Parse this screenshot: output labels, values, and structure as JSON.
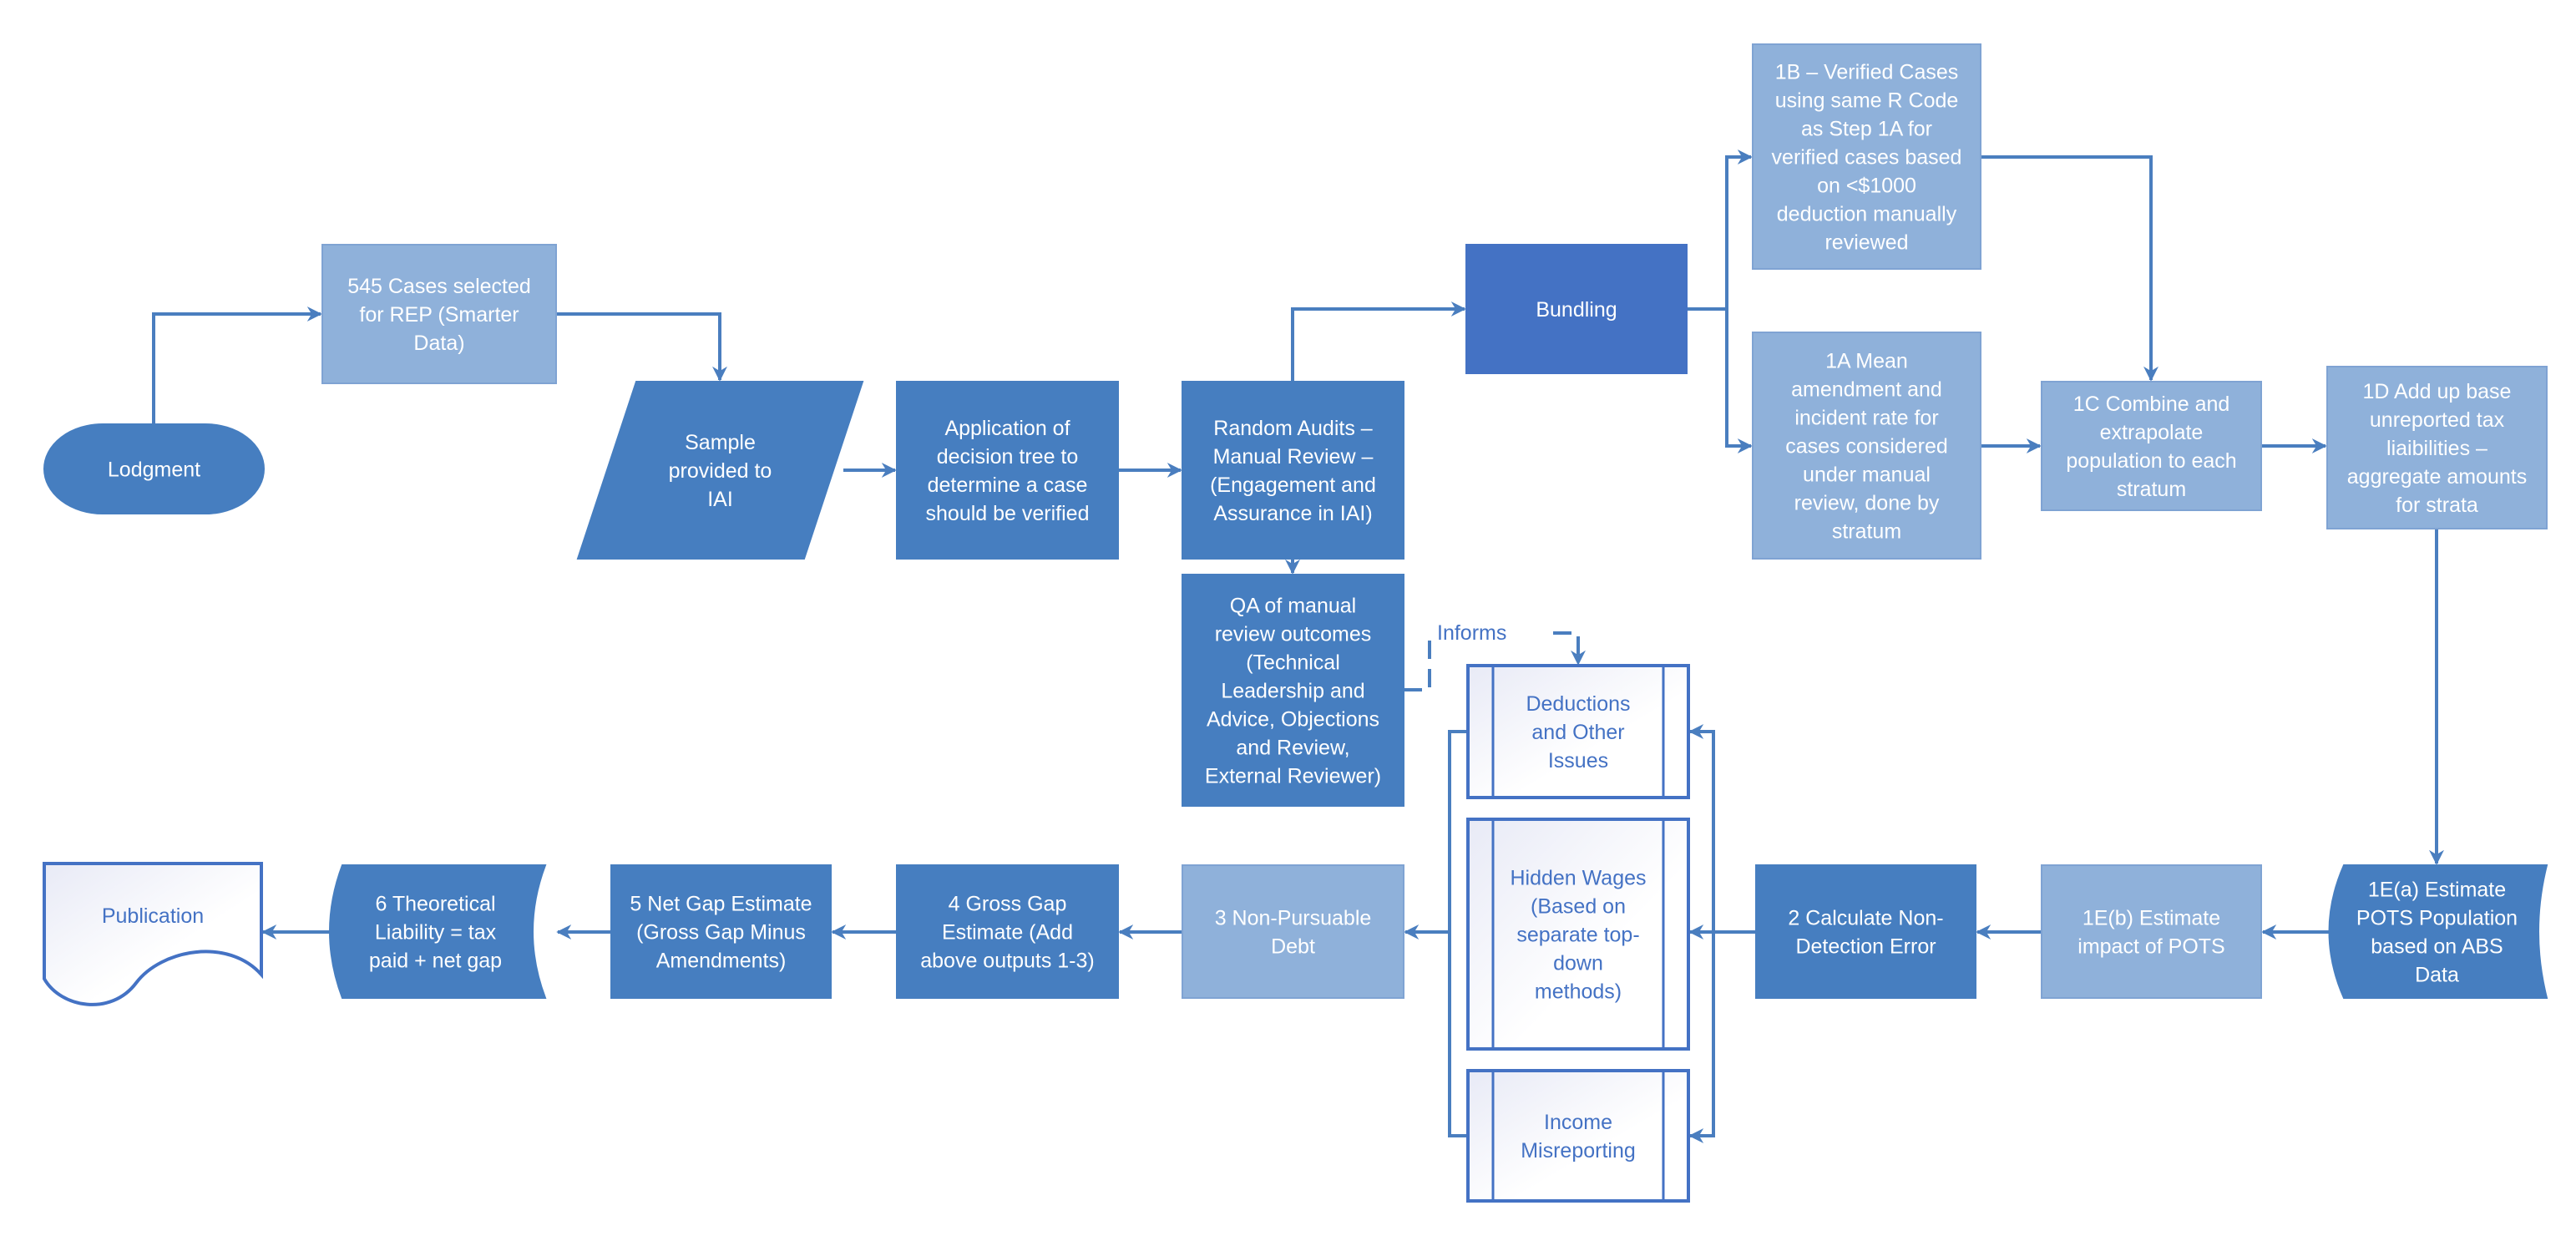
{
  "colors": {
    "dark": "#467ec0",
    "bundling": "#4472c4",
    "light": "#8fb1da",
    "outline": "#4472c4",
    "connector": "#4a7ebf",
    "text_light": "#ffffff",
    "text_outline": "#4472c4"
  },
  "nodes": [
    {
      "id": "lodgment",
      "shape": "terminator",
      "style": "dark",
      "lines": [
        "Lodgment"
      ]
    },
    {
      "id": "cases-selected",
      "shape": "process",
      "style": "light",
      "lines": [
        "545 Cases selected",
        "for REP (Smarter",
        "Data)"
      ]
    },
    {
      "id": "sample-provided",
      "shape": "data",
      "style": "dark",
      "lines": [
        "Sample",
        "provided to",
        "IAI"
      ]
    },
    {
      "id": "decision-tree",
      "shape": "process",
      "style": "dark",
      "lines": [
        "Application of",
        "decision tree to",
        "determine a case",
        "should be verified"
      ]
    },
    {
      "id": "random-audits",
      "shape": "process",
      "style": "dark",
      "lines": [
        "Random Audits –",
        "Manual Review –",
        "(Engagement and",
        "Assurance in IAI)"
      ]
    },
    {
      "id": "bundling",
      "shape": "process",
      "style": "bundling",
      "lines": [
        "Bundling"
      ]
    },
    {
      "id": "step-1b",
      "shape": "process",
      "style": "light",
      "lines": [
        "1B – Verified Cases",
        "using same R Code",
        "as Step 1A for",
        "verified cases based",
        "on <$1000",
        "deduction manually",
        "reviewed"
      ]
    },
    {
      "id": "step-1a",
      "shape": "process",
      "style": "light",
      "lines": [
        "1A Mean",
        "amendment and",
        "incident rate for",
        "cases considered",
        "under manual",
        "review, done by",
        "stratum"
      ]
    },
    {
      "id": "step-1c",
      "shape": "process",
      "style": "light",
      "lines": [
        "1C Combine and",
        "extrapolate",
        "population to each",
        "stratum"
      ]
    },
    {
      "id": "step-1d",
      "shape": "process",
      "style": "light",
      "lines": [
        "1D Add up base",
        "unreported tax",
        "liaibilities –",
        "aggregate amounts",
        "for strata"
      ]
    },
    {
      "id": "qa-review",
      "shape": "process",
      "style": "dark",
      "lines": [
        "QA of manual",
        "review outcomes",
        "(Technical",
        "Leadership and",
        "Advice, Objections",
        "and Review,",
        "External Reviewer)"
      ]
    },
    {
      "id": "deductions",
      "shape": "subprocess",
      "style": "outline",
      "lines": [
        "Deductions",
        "and Other",
        "Issues"
      ]
    },
    {
      "id": "hidden-wages",
      "shape": "subprocess",
      "style": "outline",
      "lines": [
        "Hidden Wages",
        "(Based on",
        "separate top-",
        "down",
        "methods)"
      ]
    },
    {
      "id": "income-misreporting",
      "shape": "subprocess",
      "style": "outline",
      "lines": [
        "Income",
        "Misreporting"
      ]
    },
    {
      "id": "step-1ea",
      "shape": "stored-data-right",
      "style": "dark",
      "lines": [
        "1E(a) Estimate",
        "POTS Population",
        "based on ABS",
        "Data"
      ]
    },
    {
      "id": "step-1eb",
      "shape": "process",
      "style": "light",
      "lines": [
        "1E(b) Estimate",
        "impact of POTS"
      ]
    },
    {
      "id": "step-2",
      "shape": "process",
      "style": "dark",
      "lines": [
        "2 Calculate Non-",
        "Detection Error"
      ]
    },
    {
      "id": "step-3",
      "shape": "process",
      "style": "light",
      "lines": [
        "3 Non-Pursuable",
        "Debt"
      ]
    },
    {
      "id": "step-4",
      "shape": "process",
      "style": "dark",
      "lines": [
        "4 Gross Gap",
        "Estimate (Add",
        "above outputs 1-3)"
      ]
    },
    {
      "id": "step-5",
      "shape": "process",
      "style": "dark",
      "lines": [
        "5 Net Gap Estimate",
        "(Gross Gap Minus",
        "Amendments)"
      ]
    },
    {
      "id": "step-6",
      "shape": "stored-data-left",
      "style": "dark",
      "lines": [
        "6 Theoretical",
        "Liability = tax",
        "paid + net gap"
      ]
    },
    {
      "id": "publication",
      "shape": "document",
      "style": "outline",
      "lines": [
        "Publication"
      ]
    }
  ],
  "edges": [
    {
      "id": "e1",
      "from": "lodgment",
      "to": "cases-selected"
    },
    {
      "id": "e2",
      "from": "cases-selected",
      "to": "sample-provided"
    },
    {
      "id": "e3",
      "from": "sample-provided",
      "to": "decision-tree"
    },
    {
      "id": "e4",
      "from": "decision-tree",
      "to": "random-audits"
    },
    {
      "id": "e5",
      "from": "random-audits",
      "to": "bundling"
    },
    {
      "id": "e6",
      "from": "random-audits",
      "to": "qa-review"
    },
    {
      "id": "e7",
      "from": "bundling",
      "to": "step-1b"
    },
    {
      "id": "e8",
      "from": "bundling",
      "to": "step-1a"
    },
    {
      "id": "e9",
      "from": "step-1b",
      "to": "step-1c"
    },
    {
      "id": "e10",
      "from": "step-1a",
      "to": "step-1c"
    },
    {
      "id": "e11",
      "from": "step-1c",
      "to": "step-1d"
    },
    {
      "id": "e12",
      "from": "step-1d",
      "to": "step-1ea"
    },
    {
      "id": "e13",
      "from": "step-1ea",
      "to": "step-1eb"
    },
    {
      "id": "e14",
      "from": "step-1eb",
      "to": "step-2"
    },
    {
      "id": "e15",
      "from": "step-2",
      "to": "deductions"
    },
    {
      "id": "e16",
      "from": "step-2",
      "to": "hidden-wages"
    },
    {
      "id": "e17",
      "from": "step-2",
      "to": "income-misreporting"
    },
    {
      "id": "e18",
      "from": "hidden-wages",
      "to": "step-3"
    },
    {
      "id": "e19",
      "from": "step-3",
      "to": "step-4"
    },
    {
      "id": "e20",
      "from": "step-4",
      "to": "step-5"
    },
    {
      "id": "e21",
      "from": "step-5",
      "to": "step-6"
    },
    {
      "id": "e22",
      "from": "step-6",
      "to": "publication"
    },
    {
      "id": "e23",
      "from": "qa-review",
      "to": "deductions",
      "style": "dashed",
      "label": "Informs"
    }
  ]
}
